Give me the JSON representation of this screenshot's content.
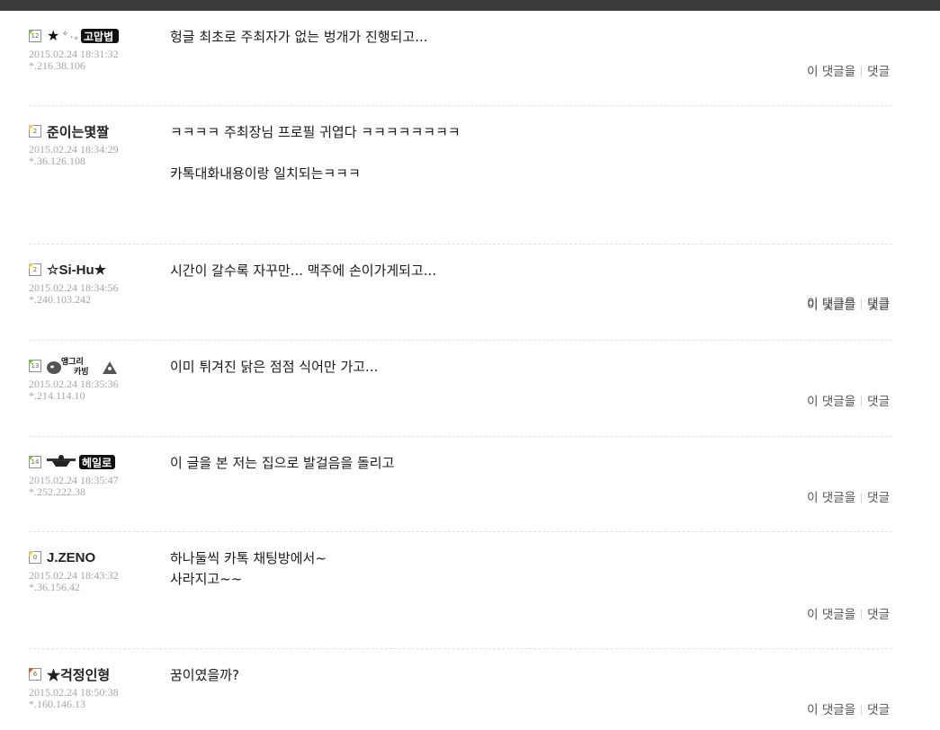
{
  "actions": {
    "this_reply": "이 댓글을",
    "reply": "댓글"
  },
  "comments": [
    {
      "level": "12",
      "level_color": "#7bc043",
      "nickname": "★✧⁺고맙볍",
      "date": "2015.02.24 18:31:32",
      "ip": "*.216.38.106",
      "lines": [
        "헝글 최초로 주최자가 없는 벙개가 진행되고..."
      ]
    },
    {
      "level": "2",
      "level_color": "#f2c94c",
      "nickname": "준이는몇짤",
      "date": "2015.02.24 18:34:29",
      "ip": "*.36.126.108",
      "lines": [
        "ㅋㅋㅋㅋ 주최장님 프로필 귀엽다 ㅋㅋㅋㅋㅋㅋㅋㅋ",
        "",
        "카톡대화내용이랑 일치되는ㅋㅋㅋ"
      ]
    },
    {
      "level": "2",
      "level_color": "#f2c94c",
      "nickname": "☆Si-Hu★",
      "date": "2015.02.24 18:34:56",
      "ip": "*.240.103.242",
      "lines": [
        "시간이 갈수록 자꾸만... 맥주에 손이가게되고..."
      ]
    },
    {
      "level": "13",
      "level_color": "#7bc043",
      "nickname": "앵그리 카빙",
      "date": "2015.02.24 18:35:36",
      "ip": "*.214.114.10",
      "lines": [
        "이미 튀겨진 닭은 점점 식어만 가고..."
      ]
    },
    {
      "level": "14",
      "level_color": "#7bc043",
      "nickname": "헤일로",
      "date": "2015.02.24 18:35:47",
      "ip": "*.252.222.38",
      "lines": [
        "이 글을 본 저는 집으로 발걸음을 돌리고"
      ]
    },
    {
      "level": "0",
      "level_color": "#f2c94c",
      "nickname": "J.ZENO",
      "date": "2015.02.24 18:43:32",
      "ip": "*.36.156.42",
      "lines": [
        "하나둘씩 카톡 채팅방에서~",
        "사라지고~~"
      ]
    },
    {
      "level": "6",
      "level_color": "#e05a2a",
      "nickname": "★걱정인형",
      "date": "2015.02.24 18:50:38",
      "ip": "*.160.146.13",
      "lines": [
        "꿈이였을까?"
      ]
    }
  ]
}
